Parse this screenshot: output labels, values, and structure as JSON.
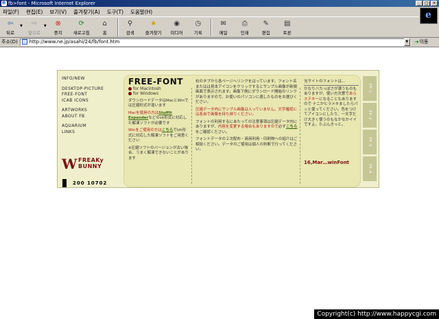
{
  "window": {
    "title": "fb>font - Microsoft Internet Explorer"
  },
  "menu": [
    "파일(F)",
    "편집(E)",
    "보기(V)",
    "즐겨찾기(A)",
    "도구(T)",
    "도움말(H)"
  ],
  "toolbar": [
    {
      "id": "back",
      "label": "뒤로",
      "icon": "arrow-left-icon"
    },
    {
      "id": "forward",
      "label": "앞으로",
      "icon": "arrow-right-icon"
    },
    {
      "id": "stop",
      "label": "중지",
      "icon": "stop-icon"
    },
    {
      "id": "refresh",
      "label": "새로고침",
      "icon": "refresh-icon"
    },
    {
      "id": "home",
      "label": "홈",
      "icon": "home-icon"
    },
    {
      "id": "search",
      "label": "검색",
      "icon": "search-icon"
    },
    {
      "id": "favorites",
      "label": "즐겨찾기",
      "icon": "favorites-icon"
    },
    {
      "id": "media",
      "label": "미디어",
      "icon": "media-icon"
    },
    {
      "id": "history",
      "label": "기록",
      "icon": "history-icon"
    },
    {
      "id": "mail",
      "label": "메일",
      "icon": "mail-icon"
    },
    {
      "id": "print",
      "label": "인쇄",
      "icon": "print-icon"
    },
    {
      "id": "edit",
      "label": "편집",
      "icon": "edit-icon"
    },
    {
      "id": "discuss",
      "label": "토론",
      "icon": "discuss-icon"
    }
  ],
  "address": {
    "label": "주소(D)",
    "url": "http://www.ne.jp/asahi/24/fb/font.htm",
    "go_label": "이동"
  },
  "page": {
    "nav_top": [
      "INFO/NEW"
    ],
    "nav_mid": [
      "DESKTOP-PICTURE",
      "FREE-FONT",
      "ICAB ICONS"
    ],
    "nav_mid2": [
      "ARTWORKS",
      "ABOUT FB"
    ],
    "nav_bottom": [
      "AQUARIUM",
      "LINKS"
    ],
    "logo_line1": "FREAKy",
    "logo_line2": "BUNNY",
    "counter": "200 10702",
    "title": "FREE-FONT",
    "os1": "for Macintosh",
    "os2": "for Windows",
    "col1_p1": "ダウンロードデータはMacとWinでは圧縮形式が違います",
    "col1_p2a": "Macを使用の方は",
    "col1_p2_link": "StuffIt Expander",
    "col1_p2b": "などのsit形式に対応した解凍ソフトが必要です",
    "col1_p3a": "Winをご使用の方は",
    "col1_p3_link": "こちら",
    "col1_p3b": "でlzh形式に対応した解凍ソフトをご用意ください",
    "col1_p4": "※圧縮ソフトのバージョンが古い場合、うまく解凍できないことがあります",
    "col2_p1": "右のタブから各ページへリンクをはっています。フォント名またはは見本アイコンをクリックするとサンプル画像が新規画面で表示されます。画像下側にダウンロード開始のリンクがありますので、お使いのパソコンに適したものをお選びください。",
    "col2_p2": "圧縮データ内にサンプル画像は入っていません。文字確認には各自で画像を持ち帰りください。",
    "col2_p3a": "フォントの利用するにあたっての注意事項は圧縮データ内にありますが、",
    "col2_p3_red": "内容を変更する場合もありますので",
    "col2_p3b": "必ず",
    "col2_p3_link": "こちら",
    "col2_p3c": "をご確認ください。",
    "col2_p4": "フォントデータの２次配布・商用利用・印刷物への紹介はご相談ください。データのご使用は個人の判断で行ってください。",
    "col3_head": "当サイトのフォントは…",
    "col3_p1a": "かなりバカっぽさが漂うものもありますが、使い方次第で",
    "col3_p1_red": "あらステキー",
    "col3_p1b": "になることもありますので ナニかヒラメキましたらパッと使ってください。色をつけてアイコンにしたり、一文字だけ大きく使うのもなかなかイイですよ。たぶんきっと。",
    "date": "16,Mar…winFont",
    "tabs": [
      "FF-1",
      "FF-2",
      "FF-3",
      "FF-4"
    ]
  },
  "copyright": "Copyright(c) http://www.happycgi.com"
}
